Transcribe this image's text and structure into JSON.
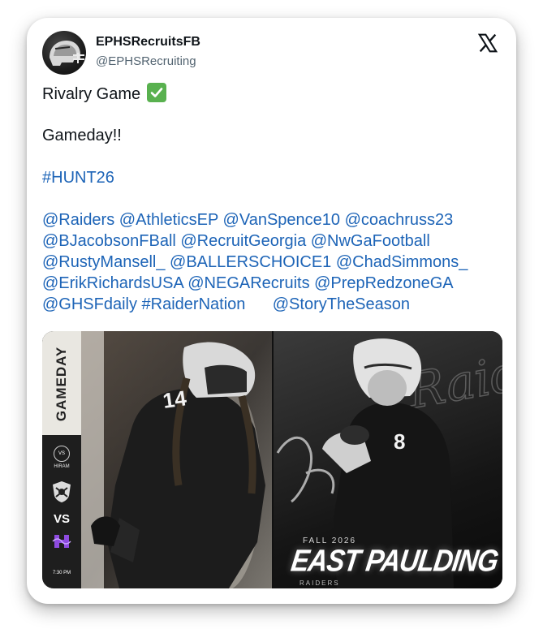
{
  "account": {
    "display_name": "EPHSRecruitsFB",
    "handle": "@EPHSRecruiting"
  },
  "tweet": {
    "line1": "Rivalry Game",
    "line2": "Gameday!!",
    "hashtag": "#HUNT26",
    "mention_lines": [
      "@Raiders @AthleticsEP @VanSpence10 @coachruss23",
      "@BJacobsonFBall @RecruitGeorgia @NwGaFootball",
      "@RustyMansell_ @BALLERSCHOICE1 @ChadSimmons_",
      "@ErikRichardsUSA @NEGARecruits @PrepRedzoneGA",
      "@GHSFdaily #RaiderNation      @StoryTheSeason"
    ]
  },
  "media": {
    "left": {
      "gameday": "GAMEDAY",
      "vs_badge": "VS",
      "opponent": "HIRAM",
      "raiders_logo": "RAIDERS",
      "vs": "VS",
      "time": "7:30 PM",
      "jersey_number": "14"
    },
    "right": {
      "season": "FALL 2026",
      "team": "EAST PAULDING",
      "team_sub": "RAIDERS",
      "script": "Raiders",
      "jersey_number": "8"
    }
  },
  "icons": {
    "brand": "x-logo-icon",
    "check": "check-mark-icon",
    "avatar": "helmet-icon"
  },
  "colors": {
    "link": "#1d64b7",
    "text": "#0f1419",
    "handle": "#536471",
    "check_bg": "#59b14f"
  }
}
